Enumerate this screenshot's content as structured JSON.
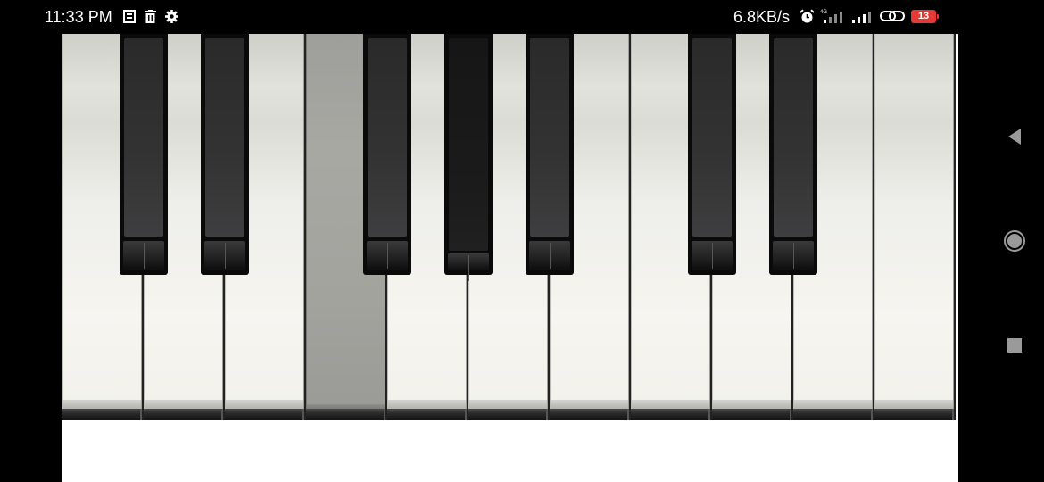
{
  "status_bar": {
    "time": "11:33 PM",
    "net_speed": "6.8KB/s",
    "battery_level": "13",
    "icons_left": [
      "notes-icon",
      "trash-icon",
      "settings-gear-icon"
    ],
    "icons_right": [
      "alarm-icon",
      "signal-4g-icon",
      "signal-icon",
      "link-icon",
      "battery-icon"
    ]
  },
  "piano": {
    "white_keys": 11,
    "black_key_slots": [
      1,
      2,
      4,
      5,
      6,
      8,
      9
    ],
    "pressed_white_key": 4,
    "colors": {
      "white": "#f2f1ec",
      "black": "#0a0a0a",
      "pressed_white": "#a3a39e"
    }
  },
  "nav_bar": {
    "buttons": [
      "back-icon",
      "home-icon",
      "recents-icon"
    ]
  }
}
